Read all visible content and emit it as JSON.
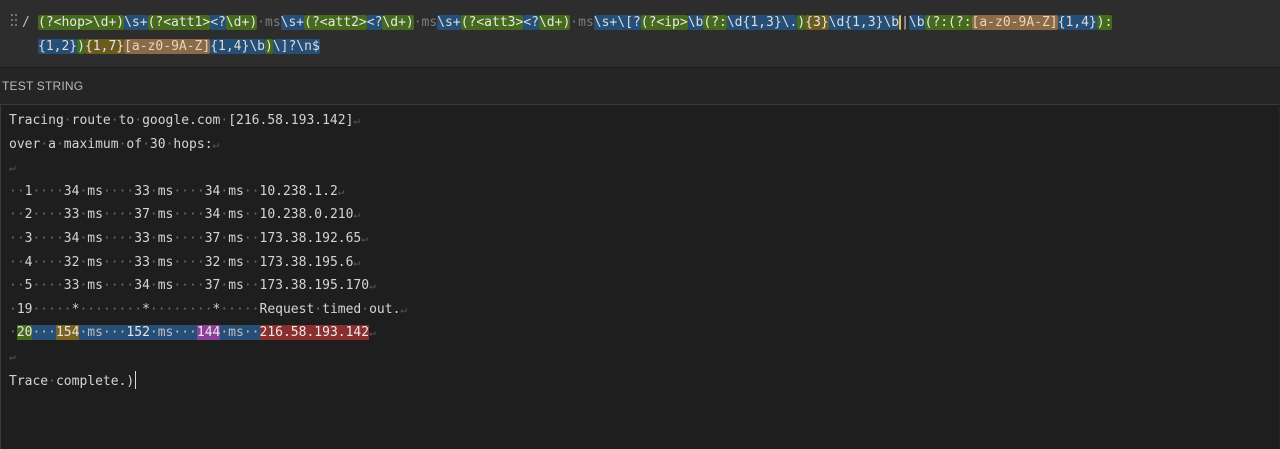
{
  "regex": {
    "delimiter_open": "/",
    "line1_tokens": [
      {
        "text": "(?<hop>\\d+)",
        "cls": "g"
      },
      {
        "text": "\\s+",
        "cls": "bl"
      },
      {
        "text": "(?<att1>",
        "cls": "g"
      },
      {
        "text": "<?",
        "cls": "bl"
      },
      {
        "text": "\\d+)",
        "cls": "g"
      },
      {
        "text": "·ms",
        "cls": "sp"
      },
      {
        "text": "\\s+",
        "cls": "bl"
      },
      {
        "text": "(?<att2>",
        "cls": "g"
      },
      {
        "text": "<?",
        "cls": "bl"
      },
      {
        "text": "\\d+)",
        "cls": "g"
      },
      {
        "text": "·ms",
        "cls": "sp"
      },
      {
        "text": "\\s+",
        "cls": "bl"
      },
      {
        "text": "(?<att3>",
        "cls": "g"
      },
      {
        "text": "<?",
        "cls": "bl"
      },
      {
        "text": "\\d+)",
        "cls": "g"
      },
      {
        "text": "·ms",
        "cls": "sp"
      },
      {
        "text": "\\s+\\[?",
        "cls": "bl"
      },
      {
        "text": "(?<ip>",
        "cls": "g"
      },
      {
        "text": "\\b",
        "cls": "bl"
      },
      {
        "text": "(?:",
        "cls": "g"
      },
      {
        "text": "\\d{1,3}\\.",
        "cls": "bl"
      },
      {
        "text": ")",
        "cls": "g"
      },
      {
        "text": "{3}",
        "cls": "q"
      },
      {
        "text": "\\d{1,3}\\b",
        "cls": "bl"
      },
      {
        "text": "|",
        "cls": "alt"
      },
      {
        "text": "\\b",
        "cls": "bl"
      },
      {
        "text": "(?:(?:",
        "cls": "g"
      },
      {
        "text": "[a-z0-9A-Z]",
        "cls": "cls"
      },
      {
        "text": "{1,4}",
        "cls": "bl"
      },
      {
        "text": "):",
        "cls": "g"
      }
    ],
    "line2_tokens": [
      {
        "text": "{1,2}",
        "cls": "bl"
      },
      {
        "text": ")",
        "cls": "g"
      },
      {
        "text": "{1,7}",
        "cls": "q"
      },
      {
        "text": "[a-z0-9A-Z]",
        "cls": "cls"
      },
      {
        "text": "{1,4}\\b",
        "cls": "bl"
      },
      {
        "text": ")",
        "cls": "g"
      },
      {
        "text": "\\]?\\n$",
        "cls": "bl"
      }
    ]
  },
  "section_title": "TEST STRING",
  "test_lines": [
    [
      {
        "text": "Tracing"
      },
      {
        "text": "·",
        "cls": "ws"
      },
      {
        "text": "route"
      },
      {
        "text": "·",
        "cls": "ws"
      },
      {
        "text": "to"
      },
      {
        "text": "·",
        "cls": "ws"
      },
      {
        "text": "google.com"
      },
      {
        "text": "·",
        "cls": "ws"
      },
      {
        "text": "[216.58.193.142]"
      },
      {
        "text": "↵",
        "cls": "nl"
      }
    ],
    [
      {
        "text": "over"
      },
      {
        "text": "·",
        "cls": "ws"
      },
      {
        "text": "a"
      },
      {
        "text": "·",
        "cls": "ws"
      },
      {
        "text": "maximum"
      },
      {
        "text": "·",
        "cls": "ws"
      },
      {
        "text": "of"
      },
      {
        "text": "·",
        "cls": "ws"
      },
      {
        "text": "30"
      },
      {
        "text": "·",
        "cls": "ws"
      },
      {
        "text": "hops:"
      },
      {
        "text": "↵",
        "cls": "nl"
      }
    ],
    [
      {
        "text": "↵",
        "cls": "nl"
      }
    ],
    [
      {
        "text": "··",
        "cls": "ws"
      },
      {
        "text": "1"
      },
      {
        "text": "····",
        "cls": "ws"
      },
      {
        "text": "34"
      },
      {
        "text": "·",
        "cls": "ws"
      },
      {
        "text": "ms"
      },
      {
        "text": "····",
        "cls": "ws"
      },
      {
        "text": "33"
      },
      {
        "text": "·",
        "cls": "ws"
      },
      {
        "text": "ms"
      },
      {
        "text": "····",
        "cls": "ws"
      },
      {
        "text": "34"
      },
      {
        "text": "·",
        "cls": "ws"
      },
      {
        "text": "ms"
      },
      {
        "text": "··",
        "cls": "ws"
      },
      {
        "text": "10.238.1.2"
      },
      {
        "text": "↵",
        "cls": "nl"
      }
    ],
    [
      {
        "text": "··",
        "cls": "ws"
      },
      {
        "text": "2"
      },
      {
        "text": "····",
        "cls": "ws"
      },
      {
        "text": "33"
      },
      {
        "text": "·",
        "cls": "ws"
      },
      {
        "text": "ms"
      },
      {
        "text": "····",
        "cls": "ws"
      },
      {
        "text": "37"
      },
      {
        "text": "·",
        "cls": "ws"
      },
      {
        "text": "ms"
      },
      {
        "text": "····",
        "cls": "ws"
      },
      {
        "text": "34"
      },
      {
        "text": "·",
        "cls": "ws"
      },
      {
        "text": "ms"
      },
      {
        "text": "··",
        "cls": "ws"
      },
      {
        "text": "10.238.0.210"
      },
      {
        "text": "↵",
        "cls": "nl"
      }
    ],
    [
      {
        "text": "··",
        "cls": "ws"
      },
      {
        "text": "3"
      },
      {
        "text": "····",
        "cls": "ws"
      },
      {
        "text": "34"
      },
      {
        "text": "·",
        "cls": "ws"
      },
      {
        "text": "ms"
      },
      {
        "text": "····",
        "cls": "ws"
      },
      {
        "text": "33"
      },
      {
        "text": "·",
        "cls": "ws"
      },
      {
        "text": "ms"
      },
      {
        "text": "····",
        "cls": "ws"
      },
      {
        "text": "37"
      },
      {
        "text": "·",
        "cls": "ws"
      },
      {
        "text": "ms"
      },
      {
        "text": "··",
        "cls": "ws"
      },
      {
        "text": "173.38.192.65"
      },
      {
        "text": "↵",
        "cls": "nl"
      }
    ],
    [
      {
        "text": "··",
        "cls": "ws"
      },
      {
        "text": "4"
      },
      {
        "text": "····",
        "cls": "ws"
      },
      {
        "text": "32"
      },
      {
        "text": "·",
        "cls": "ws"
      },
      {
        "text": "ms"
      },
      {
        "text": "····",
        "cls": "ws"
      },
      {
        "text": "33"
      },
      {
        "text": "·",
        "cls": "ws"
      },
      {
        "text": "ms"
      },
      {
        "text": "····",
        "cls": "ws"
      },
      {
        "text": "32"
      },
      {
        "text": "·",
        "cls": "ws"
      },
      {
        "text": "ms"
      },
      {
        "text": "··",
        "cls": "ws"
      },
      {
        "text": "173.38.195.6"
      },
      {
        "text": "↵",
        "cls": "nl"
      }
    ],
    [
      {
        "text": "··",
        "cls": "ws"
      },
      {
        "text": "5"
      },
      {
        "text": "····",
        "cls": "ws"
      },
      {
        "text": "33"
      },
      {
        "text": "·",
        "cls": "ws"
      },
      {
        "text": "ms"
      },
      {
        "text": "····",
        "cls": "ws"
      },
      {
        "text": "34"
      },
      {
        "text": "·",
        "cls": "ws"
      },
      {
        "text": "ms"
      },
      {
        "text": "····",
        "cls": "ws"
      },
      {
        "text": "37"
      },
      {
        "text": "·",
        "cls": "ws"
      },
      {
        "text": "ms"
      },
      {
        "text": "··",
        "cls": "ws"
      },
      {
        "text": "173.38.195.170"
      },
      {
        "text": "↵",
        "cls": "nl"
      }
    ],
    [
      {
        "text": "·",
        "cls": "ws"
      },
      {
        "text": "19"
      },
      {
        "text": "·····",
        "cls": "ws"
      },
      {
        "text": "*"
      },
      {
        "text": "········",
        "cls": "ws"
      },
      {
        "text": "*"
      },
      {
        "text": "········",
        "cls": "ws"
      },
      {
        "text": "*"
      },
      {
        "text": "·····",
        "cls": "ws"
      },
      {
        "text": "Request"
      },
      {
        "text": "·",
        "cls": "ws"
      },
      {
        "text": "timed"
      },
      {
        "text": "·",
        "cls": "ws"
      },
      {
        "text": "out."
      },
      {
        "text": "↵",
        "cls": "nl"
      }
    ],
    [
      {
        "text": "·",
        "cls": "ws"
      },
      {
        "text": "20",
        "cls": "m-hop"
      },
      {
        "text": "···",
        "cls": "m-sp"
      },
      {
        "text": "154",
        "cls": "m-a1"
      },
      {
        "text": "·ms···",
        "cls": "m-sp"
      },
      {
        "text": "152",
        "cls": "m-a2"
      },
      {
        "text": "·ms···",
        "cls": "m-sp"
      },
      {
        "text": "144",
        "cls": "m-a3"
      },
      {
        "text": "·ms··",
        "cls": "m-sp"
      },
      {
        "text": "216.58.193.142",
        "cls": "m-ip"
      },
      {
        "text": "↵",
        "cls": "nl"
      }
    ],
    [
      {
        "text": "↵",
        "cls": "nl"
      }
    ],
    [
      {
        "text": "Trace"
      },
      {
        "text": "·",
        "cls": "ws"
      },
      {
        "text": "complete.)"
      }
    ]
  ]
}
